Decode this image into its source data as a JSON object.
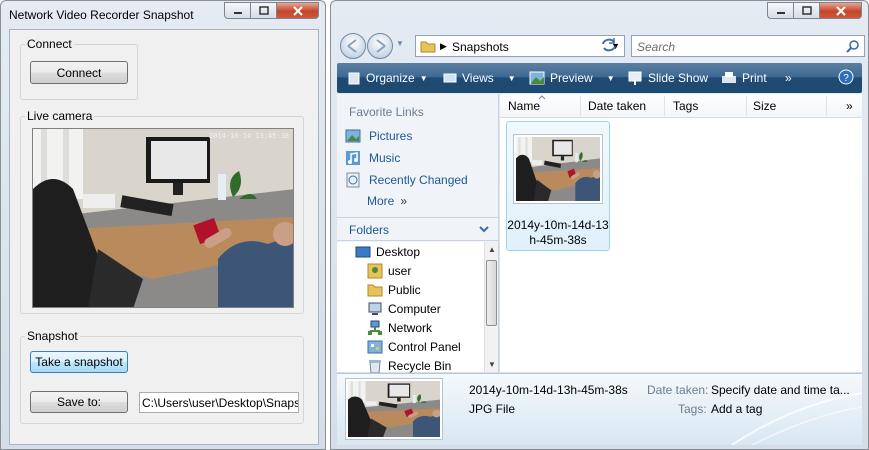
{
  "nvr": {
    "title": "Network Video Recorder Snapshot",
    "connect_group": "Connect",
    "connect_button": "Connect",
    "camera_group": "Live camera",
    "camera_timestamp": "2014-10-14 13:45:38",
    "snapshot_group": "Snapshot",
    "snapshot_button": "Take a snapshot",
    "save_button": "Save to:",
    "save_path": "C:\\Users\\user\\Desktop\\Snapshots"
  },
  "explorer": {
    "address": {
      "location": "Snapshots"
    },
    "search_placeholder": "Search",
    "toolbar": {
      "organize": "Organize",
      "views": "Views",
      "preview": "Preview",
      "slideshow": "Slide Show",
      "print": "Print",
      "more": "»"
    },
    "favorites": {
      "heading": "Favorite Links",
      "items": [
        "Pictures",
        "Music",
        "Recently Changed"
      ],
      "more": "More",
      "more_chevron": "»"
    },
    "folders": {
      "heading": "Folders",
      "tree": [
        "Desktop",
        "user",
        "Public",
        "Computer",
        "Network",
        "Control Panel",
        "Recycle Bin"
      ]
    },
    "columns": [
      "Name",
      "Date taken",
      "Tags",
      "Size",
      "»"
    ],
    "file": {
      "name_line1": "2014y-10m-14d-13",
      "name_line2": "h-45m-38s"
    },
    "details": {
      "filename": "2014y-10m-14d-13h-45m-38s",
      "type": "JPG File",
      "date_label": "Date taken:",
      "date_value": "Specify date and time ta...",
      "tags_label": "Tags:",
      "tags_value": "Add a tag"
    }
  },
  "colors": {
    "toolbar": "#1f4a73",
    "link": "#1e5796",
    "selection": "#dff1fc",
    "close": "#c3462b"
  }
}
